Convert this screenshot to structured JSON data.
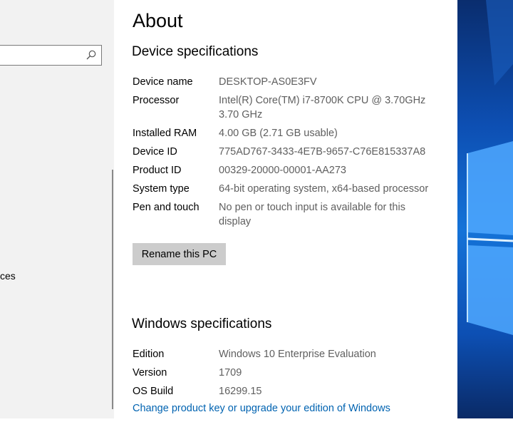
{
  "nav": {
    "search_placeholder": "",
    "partial_item": "ces"
  },
  "page": {
    "title": "About"
  },
  "device_specs": {
    "title": "Device specifications",
    "rows": [
      {
        "label": "Device name",
        "value": "DESKTOP-AS0E3FV"
      },
      {
        "label": "Processor",
        "value": "Intel(R) Core(TM) i7-8700K CPU @ 3.70GHz 3.70 GHz"
      },
      {
        "label": "Installed RAM",
        "value": "4.00 GB (2.71 GB usable)"
      },
      {
        "label": "Device ID",
        "value": "775AD767-3433-4E7B-9657-C76E815337A8"
      },
      {
        "label": "Product ID",
        "value": "00329-20000-00001-AA273"
      },
      {
        "label": "System type",
        "value": "64-bit operating system, x64-based processor"
      },
      {
        "label": "Pen and touch",
        "value": "No pen or touch input is available for this display"
      }
    ],
    "rename_button": "Rename this PC"
  },
  "windows_specs": {
    "title": "Windows specifications",
    "rows": [
      {
        "label": "Edition",
        "value": "Windows 10 Enterprise Evaluation"
      },
      {
        "label": "Version",
        "value": "1709"
      },
      {
        "label": "OS Build",
        "value": "16299.15"
      }
    ],
    "link": "Change product key or upgrade your edition of Windows"
  },
  "colors": {
    "accent_link": "#0063b1",
    "button_bg": "#cccccc",
    "value_text": "#5f5f5f"
  }
}
